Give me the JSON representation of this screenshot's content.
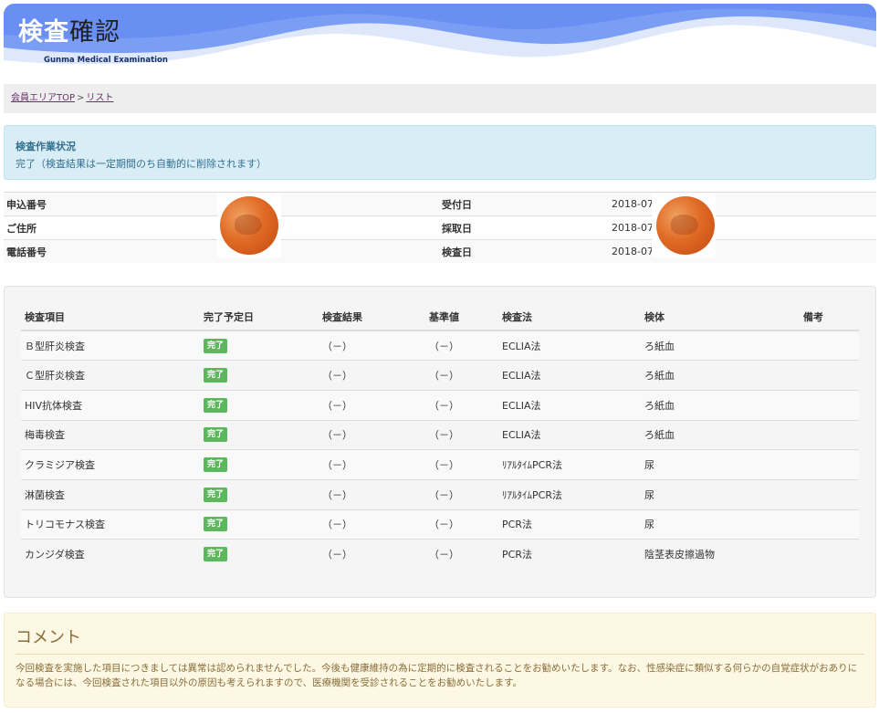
{
  "header": {
    "title_part1": "検査",
    "title_part2": "確認",
    "subtitle": "Gunma Medical Examination",
    "colors": {
      "wave_dark": "#6f95f4",
      "wave_light": "#dde6fb"
    }
  },
  "breadcrumb": {
    "home": "会員エリアTOP",
    "separator": ">",
    "current": "リスト"
  },
  "status": {
    "title": "検査作業状況",
    "text": "完了（検査結果は一定期間のち自動的に削除されます）"
  },
  "info": {
    "rows": [
      {
        "label": "申込番号",
        "value": "",
        "label2": "受付日",
        "value2": "2018-07-"
      },
      {
        "label": "ご住所",
        "value": "",
        "label2": "採取日",
        "value2": "2018-07-"
      },
      {
        "label": "電話番号",
        "value": "",
        "label2": "検査日",
        "value2": "2018-07-"
      }
    ]
  },
  "results": {
    "headers": [
      "検査項目",
      "完了予定日",
      "検査結果",
      "基準値",
      "検査法",
      "検体",
      "備考"
    ],
    "rows": [
      {
        "item": "Ｂ型肝炎検査",
        "status": "完了",
        "result": "（－）",
        "standard": "（－）",
        "method": "ECLIA法",
        "specimen": "ろ紙血",
        "note": ""
      },
      {
        "item": "Ｃ型肝炎検査",
        "status": "完了",
        "result": "（－）",
        "standard": "（－）",
        "method": "ECLIA法",
        "specimen": "ろ紙血",
        "note": ""
      },
      {
        "item": "HIV抗体検査",
        "status": "完了",
        "result": "（－）",
        "standard": "（－）",
        "method": "ECLIA法",
        "specimen": "ろ紙血",
        "note": ""
      },
      {
        "item": "梅毒検査",
        "status": "完了",
        "result": "（－）",
        "standard": "（－）",
        "method": "ECLIA法",
        "specimen": "ろ紙血",
        "note": ""
      },
      {
        "item": "クラミジア検査",
        "status": "完了",
        "result": "（－）",
        "standard": "（－）",
        "method": "ﾘｱﾙﾀｲﾑPCR法",
        "specimen": "尿",
        "note": ""
      },
      {
        "item": "淋菌検査",
        "status": "完了",
        "result": "（－）",
        "standard": "（－）",
        "method": "ﾘｱﾙﾀｲﾑPCR法",
        "specimen": "尿",
        "note": ""
      },
      {
        "item": "トリコモナス検査",
        "status": "完了",
        "result": "（－）",
        "standard": "（－）",
        "method": "PCR法",
        "specimen": "尿",
        "note": ""
      },
      {
        "item": "カンジダ検査",
        "status": "完了",
        "result": "（－）",
        "standard": "（－）",
        "method": "PCR法",
        "specimen": "陰茎表皮擦過物",
        "note": ""
      }
    ]
  },
  "comment": {
    "title": "コメント",
    "body": "今回検査を実施した項目につきましては異常は認められませんでした。今後も健康維持の為に定期的に検査されることをお勧めいたします。なお、性感染症に類似する何らかの自覚症状がおありになる場合には、今回検査された項目以外の原因も考えられますので、医療機関を受診されることをお勧めいたします。"
  }
}
